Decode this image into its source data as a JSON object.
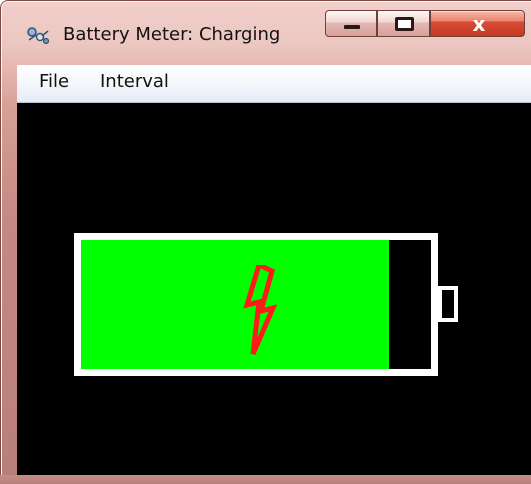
{
  "window": {
    "title": "Battery Meter: Charging",
    "icon": "battery-meter-app-icon",
    "controls": {
      "minimize": "minimize-icon",
      "maximize": "maximize-icon",
      "close_label": "x"
    }
  },
  "menu": {
    "items": [
      {
        "label": "File"
      },
      {
        "label": "Interval"
      }
    ]
  },
  "battery": {
    "state": "Charging",
    "level": 0.88,
    "charging_icon": "lightning-bolt-icon",
    "colors": {
      "background": "#000000",
      "outline": "#ffffff",
      "fill": "#00ff00",
      "bolt": "#ff1a1a"
    }
  }
}
